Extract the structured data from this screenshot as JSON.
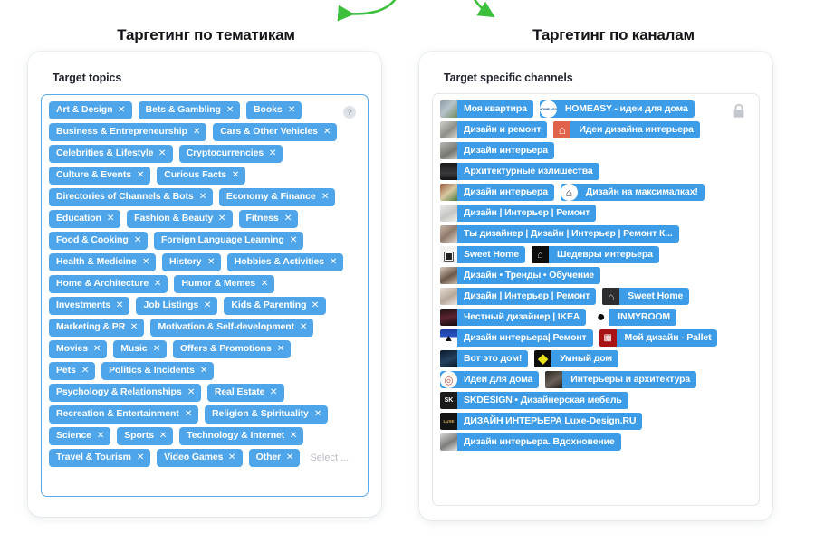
{
  "headings": {
    "left": "Таргетинг по тематикам",
    "right": "Таргетинг по каналам"
  },
  "colors": {
    "tag_blue": "#4ea5ea",
    "chip_blue": "#3c9ce8",
    "arrow_green": "#3cc03c",
    "select_border_active": "#5aa9e6",
    "select_border_idle": "#e3e6eb",
    "placeholder_gray": "#b9bdc6",
    "heading_text": "#14151a"
  },
  "left_panel": {
    "label": "Target topics",
    "help_icon": "question-mark-circle-icon",
    "placeholder": "Select ...",
    "remove_glyph": "✕",
    "rows": [
      [
        "Art & Design",
        "Bets & Gambling",
        "Books"
      ],
      [
        "Business & Entrepreneurship",
        "Cars & Other Vehicles"
      ],
      [
        "Celebrities & Lifestyle",
        "Cryptocurrencies"
      ],
      [
        "Culture & Events",
        "Curious Facts"
      ],
      [
        "Directories of Channels & Bots",
        "Economy & Finance"
      ],
      [
        "Education",
        "Fashion & Beauty",
        "Fitness"
      ],
      [
        "Food & Cooking",
        "Foreign Language Learning"
      ],
      [
        "Health & Medicine",
        "History",
        "Hobbies & Activities"
      ],
      [
        "Home & Architecture",
        "Humor & Memes"
      ],
      [
        "Investments",
        "Job Listings",
        "Kids & Parenting"
      ],
      [
        "Marketing & PR",
        "Motivation & Self-development"
      ],
      [
        "Movies",
        "Music",
        "Offers & Promotions"
      ],
      [
        "Pets",
        "Politics & Incidents"
      ],
      [
        "Psychology & Relationships",
        "Real Estate"
      ],
      [
        "Recreation & Entertainment",
        "Religion & Spirituality"
      ],
      [
        "Science",
        "Sports",
        "Technology & Internet"
      ],
      [
        "Travel & Tourism",
        "Video Games",
        "Other"
      ]
    ]
  },
  "right_panel": {
    "label": "Target specific channels",
    "lock_icon": "padlock-icon",
    "rows": [
      [
        {
          "name": "Моя квартира",
          "avatar": "photo-apartment"
        },
        {
          "name": "HOMEASY - идеи для дома",
          "avatar": "logo-homeasy-white"
        }
      ],
      [
        {
          "name": "Дизайн и ремонт",
          "avatar": "photo-interior-gray"
        },
        {
          "name": "Идеи дизайна интерьера",
          "avatar": "icon-house-orange"
        }
      ],
      [
        {
          "name": "Дизайн интерьера",
          "avatar": "photo-room-gray"
        }
      ],
      [
        {
          "name": "Архитектурные излишества",
          "avatar": "photo-dark-statue"
        }
      ],
      [
        {
          "name": "Дизайн интерьера",
          "avatar": "photo-plant-shelf"
        },
        {
          "name": "Дизайн на максималках!",
          "avatar": "icon-house-circle"
        }
      ],
      [
        {
          "name": "Дизайн | Интерьер | Ремонт",
          "avatar": "photo-lamp-light"
        }
      ],
      [
        {
          "name": "Ты дизайнер | Дизайн | Интерьер | Ремонт К...",
          "avatar": "photo-woman-window"
        }
      ],
      [
        {
          "name": "Sweet Home",
          "avatar": "photo-framed-art"
        },
        {
          "name": "Шедевры интерьера",
          "avatar": "icon-black-square"
        }
      ],
      [
        {
          "name": "Дизайн • Тренды • Обучение",
          "avatar": "photo-person-figure"
        }
      ],
      [
        {
          "name": "Дизайн | Интерьер | Ремонт",
          "avatar": "photo-bedroom"
        },
        {
          "name": "Sweet Home",
          "avatar": "icon-dark-house"
        }
      ],
      [
        {
          "name": "Честный дизайнер | IKEA",
          "avatar": "photo-dark-poster"
        },
        {
          "name": "INMYROOM",
          "avatar": "icon-black-cat"
        }
      ],
      [
        {
          "name": "Дизайн интерьера| Ремонт",
          "avatar": "icon-blue-mountain"
        },
        {
          "name": "Мой дизайн - Pallet",
          "avatar": "icon-red-pallet"
        }
      ],
      [
        {
          "name": "Вот это дом!",
          "avatar": "photo-dark-night-house"
        },
        {
          "name": "Умный дом",
          "avatar": "icon-yellow-diamond"
        }
      ],
      [
        {
          "name": "Идеи для дома",
          "avatar": "icon-round-stamp"
        },
        {
          "name": "Интерьеры и архитектура",
          "avatar": "photo-dark-interior"
        }
      ],
      [
        {
          "name": "SKDESIGN • Дизайнерская мебель",
          "avatar": "logo-sk-dark"
        }
      ],
      [
        {
          "name": "ДИЗАЙН ИНТЕРЬЕРА Luxe-Design.RU",
          "avatar": "logo-luxedesign-dark"
        }
      ],
      [
        {
          "name": "Дизайн интерьера. Вдохновение",
          "avatar": "photo-gray-lamp"
        }
      ]
    ]
  }
}
